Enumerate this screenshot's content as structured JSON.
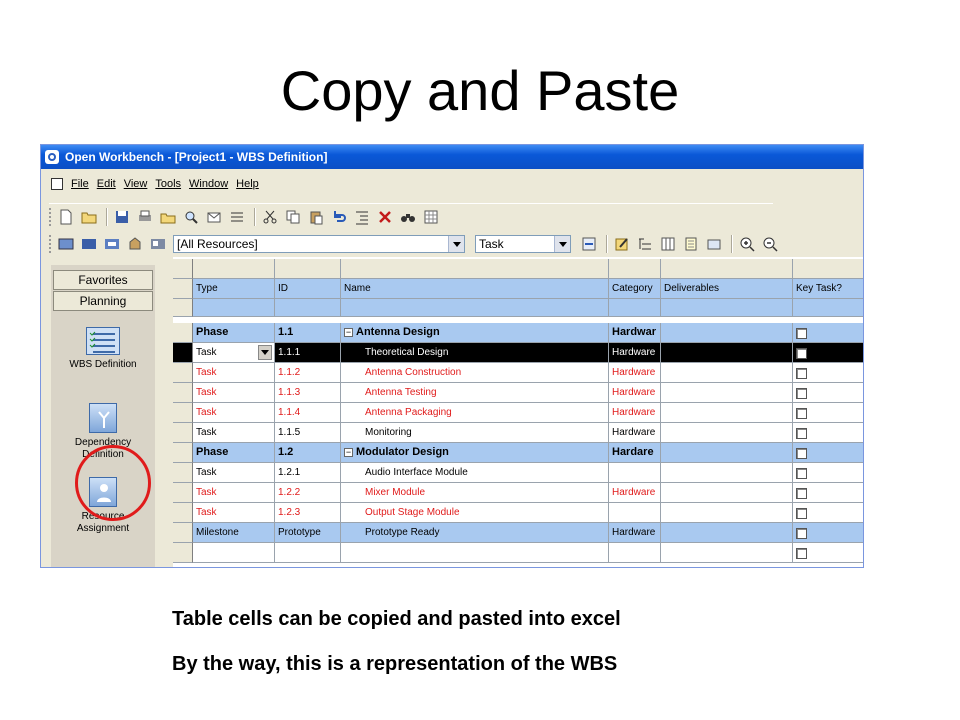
{
  "slide": {
    "title": "Copy and Paste",
    "notes": [
      "Table cells can be copied and pasted into excel",
      "By the way, this is a representation of the WBS"
    ]
  },
  "window": {
    "title": "Open Workbench - [Project1 - WBS Definition]",
    "menu": [
      "File",
      "Edit",
      "View",
      "Tools",
      "Window",
      "Help"
    ]
  },
  "toolbar": {
    "resource_filter": "[All Resources]",
    "type_filter": "Task"
  },
  "sidebar": {
    "tabs": [
      "Favorites",
      "Planning"
    ],
    "items": [
      {
        "label": "WBS Definition",
        "icon": "wbs-icon"
      },
      {
        "label": "Dependency Definition",
        "icon": "dependency-icon"
      },
      {
        "label": "Resource Assignment",
        "icon": "resource-icon"
      }
    ]
  },
  "grid": {
    "columns": [
      "Type",
      "ID",
      "Name",
      "Category",
      "Deliverables",
      "Key Task?"
    ],
    "rows": [
      {
        "type": "Phase",
        "id": "1.1",
        "name": "Antenna Design",
        "category": "Hardwar",
        "deliverables": "",
        "style": "phase"
      },
      {
        "type": "Task",
        "id": "1.1.1",
        "name": "Theoretical Design",
        "category": "Hardware",
        "deliverables": "",
        "style": "selected"
      },
      {
        "type": "Task",
        "id": "1.1.2",
        "name": "Antenna Construction",
        "category": "Hardware",
        "deliverables": "",
        "style": "red"
      },
      {
        "type": "Task",
        "id": "1.1.3",
        "name": "Antenna Testing",
        "category": "Hardware",
        "deliverables": "",
        "style": "red"
      },
      {
        "type": "Task",
        "id": "1.1.4",
        "name": "Antenna Packaging",
        "category": "Hardware",
        "deliverables": "",
        "style": "red"
      },
      {
        "type": "Task",
        "id": "1.1.5",
        "name": "Monitoring",
        "category": "Hardware",
        "deliverables": "",
        "style": "normal"
      },
      {
        "type": "Phase",
        "id": "1.2",
        "name": "Modulator Design",
        "category": "Hardare",
        "deliverables": "",
        "style": "phase"
      },
      {
        "type": "Task",
        "id": "1.2.1",
        "name": "Audio Interface Module",
        "category": "",
        "deliverables": "",
        "style": "normal"
      },
      {
        "type": "Task",
        "id": "1.2.2",
        "name": "Mixer Module",
        "category": "Hardware",
        "deliverables": "",
        "style": "red"
      },
      {
        "type": "Task",
        "id": "1.2.3",
        "name": "Output Stage Module",
        "category": "",
        "deliverables": "",
        "style": "red"
      },
      {
        "type": "Milestone",
        "id": "Prototype",
        "name": "Prototype Ready",
        "category": "Hardware",
        "deliverables": "",
        "style": "milestone"
      },
      {
        "type": "",
        "id": "",
        "name": "",
        "category": "",
        "deliverables": "",
        "style": "normal"
      }
    ]
  },
  "colors": {
    "header_blue": "#a9c9f0",
    "task_red": "#e01b1b",
    "titlebar_blue": "#0a58d8",
    "highlight_ring": "#e01b1b"
  }
}
